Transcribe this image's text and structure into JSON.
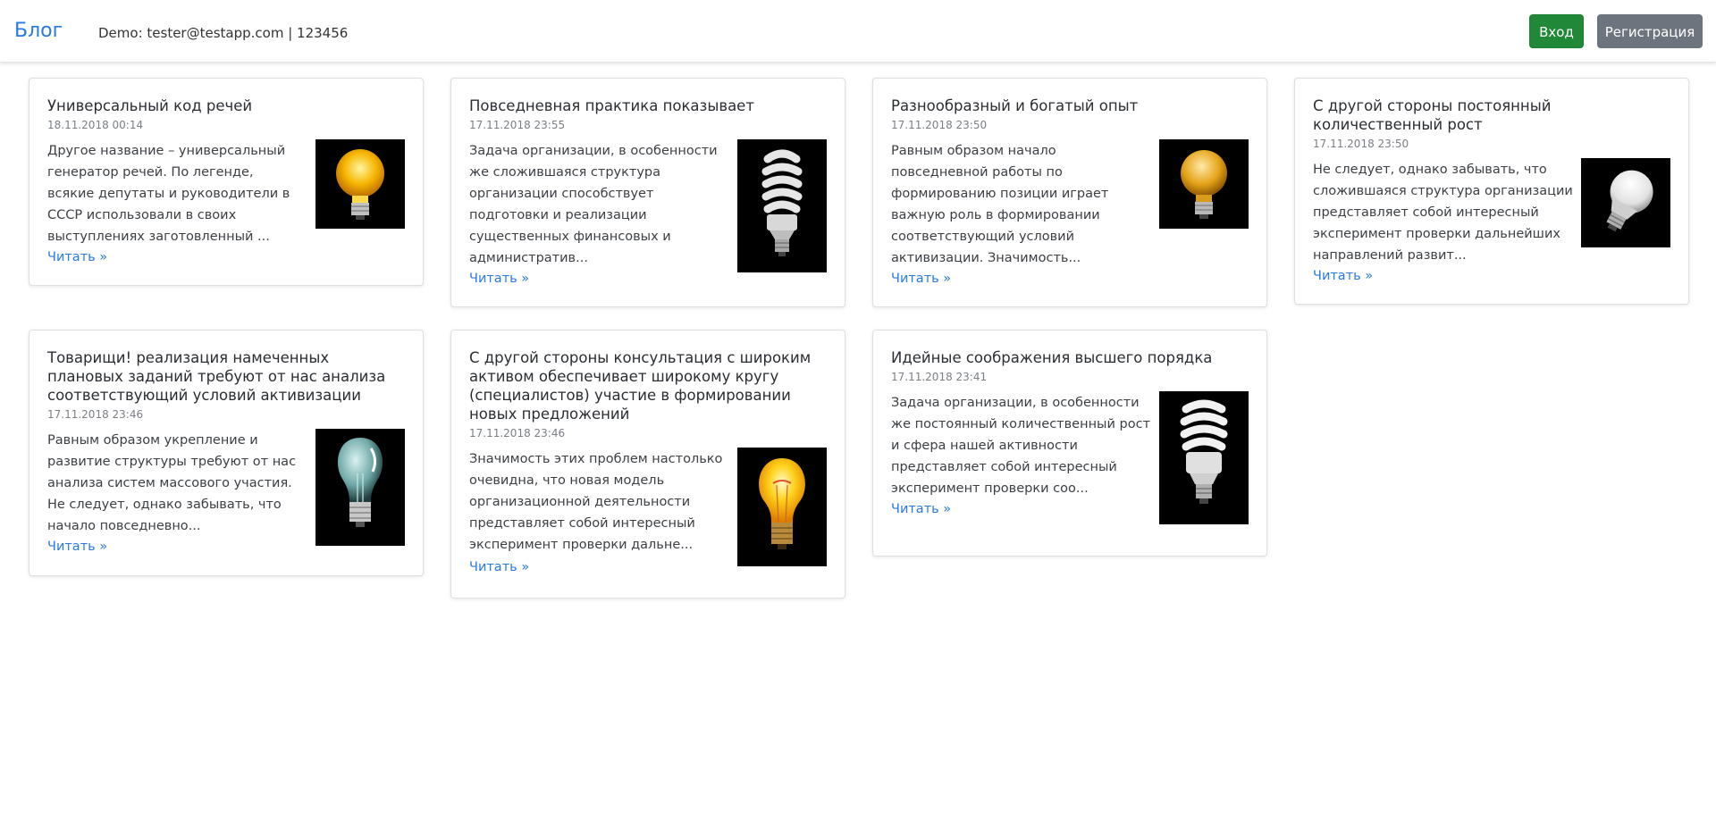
{
  "navbar": {
    "brand": "Блог",
    "demo": "Demo: tester@testapp.com | 123456",
    "login_label": "Вход",
    "register_label": "Регистрация"
  },
  "posts": [
    {
      "title": "Универсальный код речей",
      "date": "18.11.2018 00:14",
      "excerpt": "Другое название – универсальный генератор речей. По легенде, всякие депутаты и руководители в СССР использовали в своих выступлениях заготовленный ...",
      "link": "Читать »",
      "icon": "lightbulb-glowing-icon"
    },
    {
      "title": "Повседневная практика показывает",
      "date": "17.11.2018 23:55",
      "excerpt": "Задача организации, в особенности же сложившаяся структура организации способствует подготовки и реализации существенных финансовых и административ...",
      "link": "Читать »",
      "icon": "cfl-bulb-icon"
    },
    {
      "title": "Разнообразный и богатый опыт",
      "date": "17.11.2018 23:50",
      "excerpt": "Равным образом начало повседневной работы по формированию позиции играет важную роль в формировании соответствующий условий активизации. Значимость...",
      "link": "Читать »",
      "icon": "lightbulb-yellow-icon"
    },
    {
      "title": "С другой стороны постоянный количественный рост",
      "date": "17.11.2018 23:50",
      "excerpt": "Не следует, однако забывать, что сложившаяся структура организации представляет собой интересный эксперимент проверки дальнейших направлений развит...",
      "link": "Читать »",
      "icon": "led-bulb-icon"
    },
    {
      "title": "Товарищи! реализация намеченных плановых заданий требуют от нас анализа соответствующий условий активизации",
      "date": "17.11.2018 23:46",
      "excerpt": "Равным образом укрепление и развитие структуры требуют от нас анализа систем массового участия. Не следует, однако забывать, что начало повседневно...",
      "link": "Читать »",
      "icon": "lightbulb-clear-icon"
    },
    {
      "title": "С другой стороны консультация с широким активом обеспечивает широкому кругу (специалистов) участие в формировании новых предложений",
      "date": "17.11.2018 23:46",
      "excerpt": "Значимость этих проблем настолько очевидна, что новая модель организационной деятельности представляет собой интересный эксперимент проверки дальне...",
      "link": "Читать »",
      "icon": "lightbulb-filament-icon"
    },
    {
      "title": "Идейные соображения высшего порядка",
      "date": "17.11.2018 23:41",
      "excerpt": "Задача организации, в особенности же постоянный количественный рост и сфера нашей активности представляет собой интересный эксперимент проверки соо...",
      "link": "Читать »",
      "icon": "cfl-bulb-icon"
    }
  ]
}
